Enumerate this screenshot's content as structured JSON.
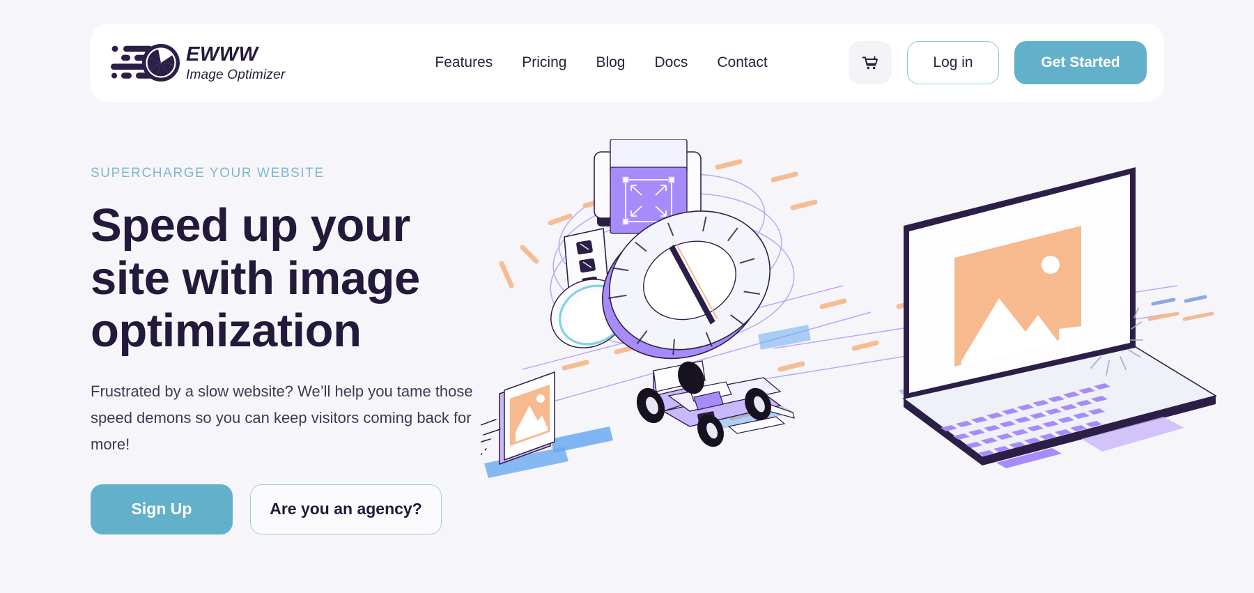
{
  "header": {
    "brand": {
      "icon": "ewww-aperture-logo-icon",
      "name": "EWWW",
      "subtitle": "Image Optimizer"
    },
    "nav": [
      {
        "label": "Features"
      },
      {
        "label": "Pricing"
      },
      {
        "label": "Blog"
      },
      {
        "label": "Docs"
      },
      {
        "label": "Contact"
      }
    ],
    "cart_icon": "shopping-cart-icon",
    "login_label": "Log in",
    "get_started_label": "Get Started"
  },
  "hero": {
    "eyebrow": "SUPERCHARGE YOUR WEBSITE",
    "title_line1": "Speed up your",
    "title_line2": "site with image",
    "title_line3": "optimization",
    "subtitle": "Frustrated by a slow website? We’ll help you tame those speed demons so you can keep visitors coming back for more!",
    "primary_cta": "Sign Up",
    "secondary_cta": "Are you an agency?",
    "illustration": "isometric-image-optimization-scene"
  },
  "colors": {
    "page_bg": "#f6f6fa",
    "card_bg": "#ffffff",
    "accent_teal": "#63b0ca",
    "accent_teal_light": "#7cb8d2",
    "text_dark": "#231a3b",
    "text_body": "#3e3952",
    "illustration_purple": "#a78bfa",
    "illustration_lavender": "#c9b8fb",
    "illustration_orange": "#f7b98e",
    "illustration_blue": "#6aaaf0"
  }
}
